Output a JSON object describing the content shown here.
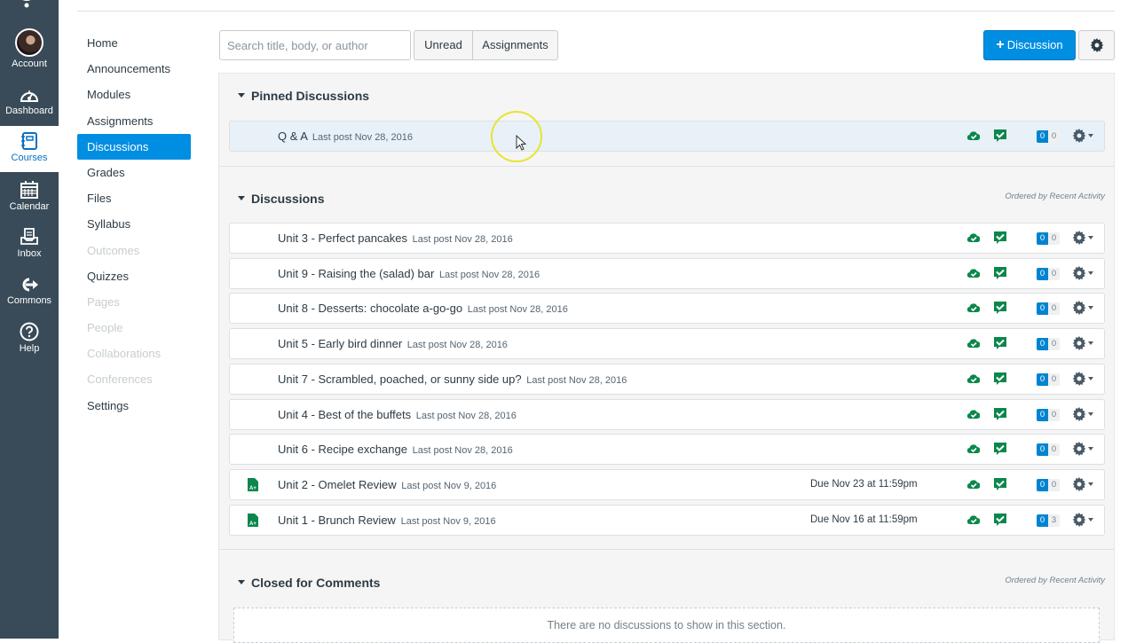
{
  "global_nav": {
    "items": [
      {
        "id": "account",
        "label": "Account",
        "icon": "avatar"
      },
      {
        "id": "dashboard",
        "label": "Dashboard",
        "icon": "dashboard-icon"
      },
      {
        "id": "courses",
        "label": "Courses",
        "icon": "courses-icon",
        "active": true
      },
      {
        "id": "calendar",
        "label": "Calendar",
        "icon": "calendar-icon"
      },
      {
        "id": "inbox",
        "label": "Inbox",
        "icon": "inbox-icon"
      },
      {
        "id": "commons",
        "label": "Commons",
        "icon": "commons-icon"
      },
      {
        "id": "help",
        "label": "Help",
        "icon": "help-icon"
      }
    ]
  },
  "course_nav": {
    "items": [
      {
        "label": "Home",
        "state": "normal"
      },
      {
        "label": "Announcements",
        "state": "normal"
      },
      {
        "label": "Modules",
        "state": "normal"
      },
      {
        "label": "Assignments",
        "state": "normal"
      },
      {
        "label": "Discussions",
        "state": "active"
      },
      {
        "label": "Grades",
        "state": "normal"
      },
      {
        "label": "Files",
        "state": "normal"
      },
      {
        "label": "Syllabus",
        "state": "normal"
      },
      {
        "label": "Outcomes",
        "state": "disabled"
      },
      {
        "label": "Quizzes",
        "state": "normal"
      },
      {
        "label": "Pages",
        "state": "disabled"
      },
      {
        "label": "People",
        "state": "disabled"
      },
      {
        "label": "Collaborations",
        "state": "disabled"
      },
      {
        "label": "Conferences",
        "state": "disabled"
      },
      {
        "label": "Settings",
        "state": "normal"
      }
    ]
  },
  "toolbar": {
    "search_placeholder": "Search title, body, or author",
    "search_value": "",
    "unread_label": "Unread",
    "assignments_label": "Assignments",
    "add_discussion_label": "Discussion",
    "add_discussion_icon": "plus-icon",
    "settings_icon": "gear-icon"
  },
  "colors": {
    "brand": "#008ee2",
    "nav_bg": "#394b58",
    "success": "#0b874b",
    "unread_badge": "#0084d1"
  },
  "sections": {
    "pinned": {
      "title": "Pinned Discussions",
      "items": [
        {
          "title": "Q & A",
          "last_post": "Last post Nov 28, 2016",
          "due": "",
          "graded": false,
          "unread": "0",
          "total": "0"
        }
      ]
    },
    "discussions": {
      "title": "Discussions",
      "order_note": "Ordered by Recent Activity",
      "items": [
        {
          "title": "Unit 3 - Perfect pancakes",
          "last_post": "Last post Nov 28, 2016",
          "due": "",
          "graded": false,
          "unread": "0",
          "total": "0"
        },
        {
          "title": "Unit 9 - Raising the (salad) bar",
          "last_post": "Last post Nov 28, 2016",
          "due": "",
          "graded": false,
          "unread": "0",
          "total": "0"
        },
        {
          "title": "Unit 8 - Desserts: chocolate a-go-go",
          "last_post": "Last post Nov 28, 2016",
          "due": "",
          "graded": false,
          "unread": "0",
          "total": "0"
        },
        {
          "title": "Unit 5 - Early bird dinner",
          "last_post": "Last post Nov 28, 2016",
          "due": "",
          "graded": false,
          "unread": "0",
          "total": "0"
        },
        {
          "title": "Unit 7 - Scrambled, poached, or sunny side up?",
          "last_post": "Last post Nov 28, 2016",
          "due": "",
          "graded": false,
          "unread": "0",
          "total": "0"
        },
        {
          "title": "Unit 4 - Best of the buffets",
          "last_post": "Last post Nov 28, 2016",
          "due": "",
          "graded": false,
          "unread": "0",
          "total": "0"
        },
        {
          "title": "Unit 6 - Recipe exchange",
          "last_post": "Last post Nov 28, 2016",
          "due": "",
          "graded": false,
          "unread": "0",
          "total": "0"
        },
        {
          "title": "Unit 2 - Omelet Review",
          "last_post": "Last post Nov 9, 2016",
          "due_label": "Due",
          "due": "Nov 23 at 11:59pm",
          "graded": true,
          "unread": "0",
          "total": "0"
        },
        {
          "title": "Unit 1 - Brunch Review",
          "last_post": "Last post Nov 9, 2016",
          "due_label": "Due",
          "due": "Nov 16 at 11:59pm",
          "graded": true,
          "unread": "0",
          "total": "3"
        }
      ]
    },
    "closed": {
      "title": "Closed for Comments",
      "order_note": "Ordered by Recent Activity",
      "empty_message": "There are no discussions to show in this section."
    }
  }
}
